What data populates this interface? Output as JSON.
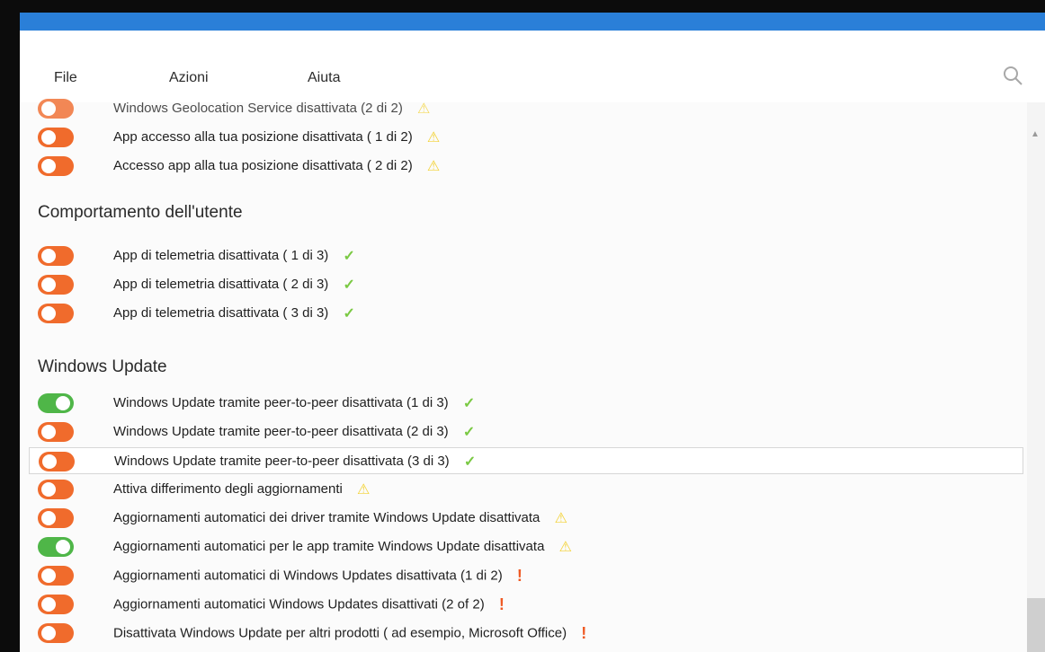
{
  "menu": {
    "file": "File",
    "azioni": "Azioni",
    "aiuta": "Aiuta"
  },
  "icons": {
    "search": "search-icon",
    "check": "checkmark-icon",
    "warning": "warning-icon",
    "alert": "exclamation-icon"
  },
  "colors": {
    "toggle_off": "#f06b2c",
    "toggle_on": "#4fb648",
    "check": "#7ac943",
    "warning": "#f3d235",
    "alert": "#ef5a24",
    "title_bar": "#2a7fd8"
  },
  "sections": {
    "location_items": [
      {
        "label": "Windows Geolocation Service disattivata (2 di 2)",
        "state": "off",
        "status": "warning"
      },
      {
        "label": "App accesso alla tua posizione disattivata ( 1 di 2)",
        "state": "off",
        "status": "warning"
      },
      {
        "label": "Accesso app alla tua posizione disattivata ( 2 di 2)",
        "state": "off",
        "status": "warning"
      }
    ],
    "user_behavior": {
      "title": "Comportamento dell'utente",
      "items": [
        {
          "label": "App di telemetria disattivata ( 1 di 3)",
          "state": "off",
          "status": "check"
        },
        {
          "label": "App di telemetria disattivata ( 2 di 3)",
          "state": "off",
          "status": "check"
        },
        {
          "label": "App di telemetria disattivata ( 3 di 3)",
          "state": "off",
          "status": "check"
        }
      ]
    },
    "windows_update": {
      "title": "Windows Update",
      "items": [
        {
          "label": "Windows Update tramite peer-to-peer disattivata (1 di 3)",
          "state": "on",
          "status": "check"
        },
        {
          "label": "Windows Update tramite peer-to-peer disattivata (2 di 3)",
          "state": "off",
          "status": "check"
        },
        {
          "label": "Windows Update tramite peer-to-peer disattivata (3 di 3)",
          "state": "off",
          "status": "check",
          "highlighted": true
        },
        {
          "label": "Attiva differimento degli aggiornamenti",
          "state": "off",
          "status": "warning"
        },
        {
          "label": "Aggiornamenti automatici dei driver tramite Windows Update disattivata",
          "state": "off",
          "status": "warning"
        },
        {
          "label": "Aggiornamenti automatici per le app tramite Windows Update disattivata",
          "state": "on",
          "status": "warning"
        },
        {
          "label": "Aggiornamenti automatici di Windows Updates disattivata (1 di 2)",
          "state": "off",
          "status": "alert"
        },
        {
          "label": "Aggiornamenti automatici Windows Updates disattivati (2 of 2)",
          "state": "off",
          "status": "alert"
        },
        {
          "label": "Disattivata Windows Update per altri prodotti ( ad esempio, Microsoft Office)",
          "state": "off",
          "status": "alert"
        }
      ]
    }
  }
}
